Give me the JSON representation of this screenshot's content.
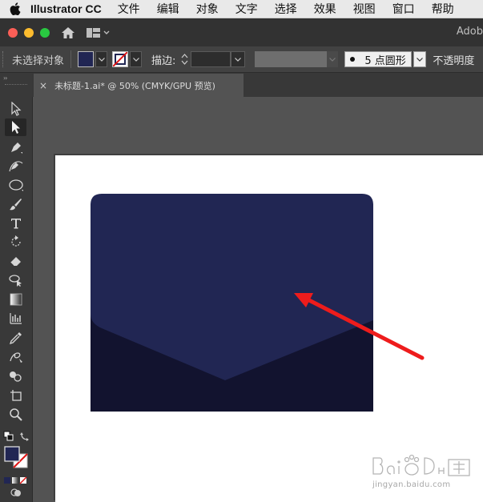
{
  "menubar": {
    "app_name": "Illustrator CC",
    "items": [
      "文件",
      "编辑",
      "对象",
      "文字",
      "选择",
      "效果",
      "视图",
      "窗口",
      "帮助"
    ]
  },
  "titlebar": {
    "brand": "Adob"
  },
  "control": {
    "selection_status": "未选择对象",
    "fill_color": "#212653",
    "stroke_label": "描边:",
    "brush_label": "5 点圆形",
    "opacity_label": "不透明度"
  },
  "document_tab": {
    "title": "未标题-1.ai* @ 50% (CMYK/GPU 预览)",
    "close": "×"
  },
  "canvas": {
    "colors": {
      "envelope_top": "#212653",
      "envelope_bottom": "#12132f",
      "arrow": "#ee1c1c"
    }
  },
  "watermark": {
    "subtitle": "jingyan.baidu.com"
  }
}
